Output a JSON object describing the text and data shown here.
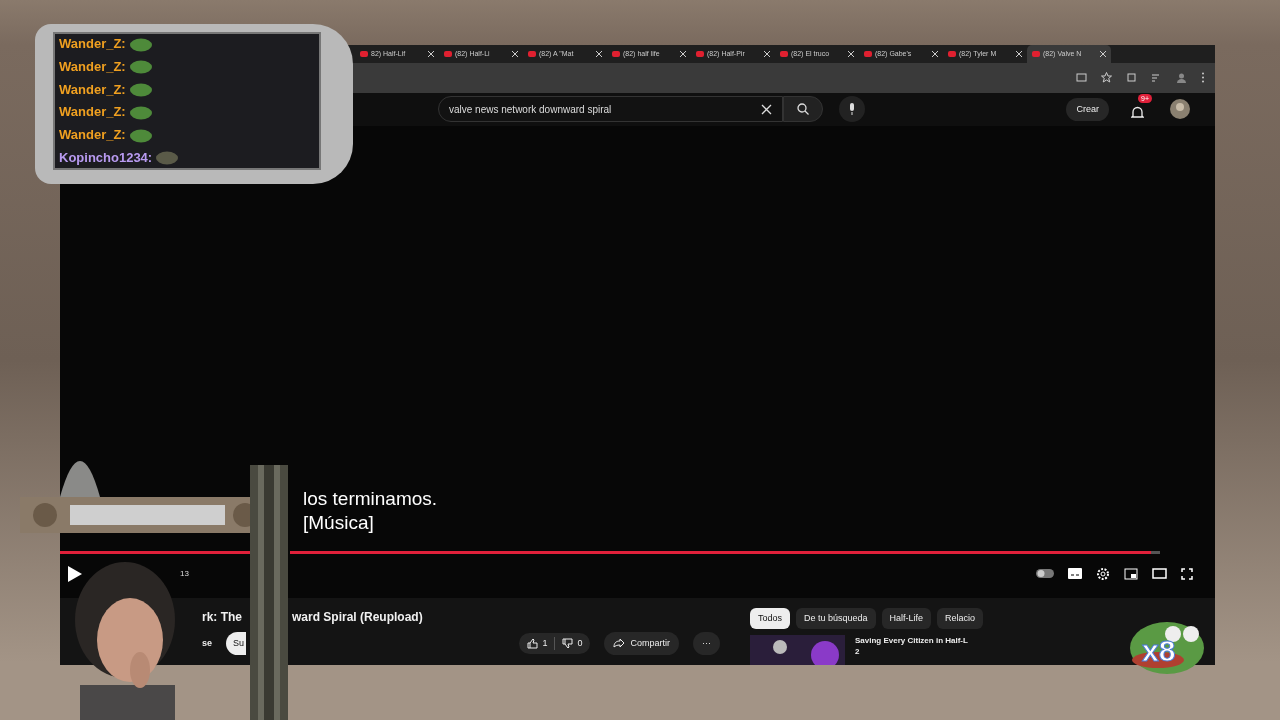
{
  "tabs": [
    {
      "label": "82) Half-Lif",
      "selected": false
    },
    {
      "label": "(82) Half-Li",
      "selected": false
    },
    {
      "label": "(82) A \"Mat",
      "selected": false
    },
    {
      "label": "(82) half life",
      "selected": false
    },
    {
      "label": "(82) Half-Pir",
      "selected": false
    },
    {
      "label": "(82) El truco",
      "selected": false
    },
    {
      "label": "(82) Gabe's",
      "selected": false
    },
    {
      "label": "(82) Tyler M",
      "selected": false
    },
    {
      "label": "(82) Valve N",
      "selected": true
    }
  ],
  "search": {
    "value": "valve news network downward spiral"
  },
  "header": {
    "create": "Crear",
    "notifications": "9+"
  },
  "video": {
    "subtitles": [
      "los terminamos.",
      "[Música]"
    ],
    "progress": {
      "level": 0.99
    },
    "time": "13"
  },
  "info": {
    "title_parts": [
      "rk: The",
      "ward Spiral (Reupload)"
    ],
    "channel": "se",
    "subscribe": "Su",
    "likes": "1",
    "dislikes": "0",
    "share": "Compartir",
    "more": "···"
  },
  "chips": [
    {
      "label": "Todos",
      "selected": true
    },
    {
      "label": "De tu búsqueda",
      "selected": false
    },
    {
      "label": "Half-Life",
      "selected": false
    },
    {
      "label": "Relacio",
      "selected": false
    }
  ],
  "recommendation": {
    "title": "Saving Every Citizen in Half-L",
    "subtitle": "2"
  },
  "chat": [
    {
      "user": "Wander_Z:",
      "color": "#f0a020"
    },
    {
      "user": "Wander_Z:",
      "color": "#f0a020"
    },
    {
      "user": "Wander_Z:",
      "color": "#f0a020"
    },
    {
      "user": "Wander_Z:",
      "color": "#f0a020"
    },
    {
      "user": "Wander_Z:",
      "color": "#f0a020"
    },
    {
      "user": "Kopincho1234:",
      "color": "#b89af0"
    }
  ],
  "emote_count": "x8"
}
